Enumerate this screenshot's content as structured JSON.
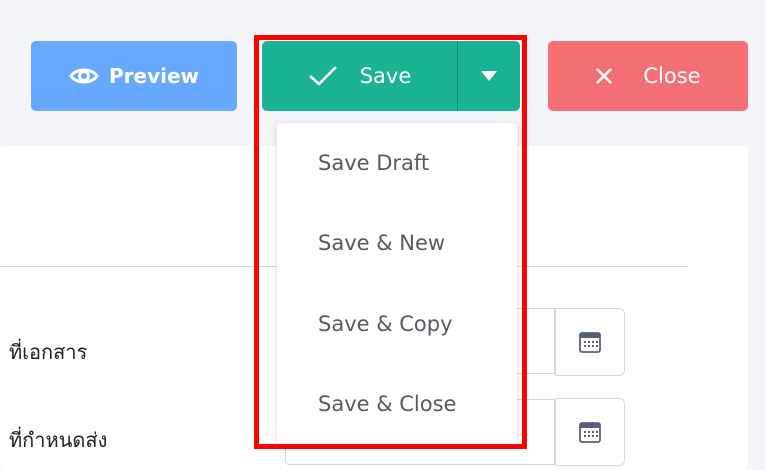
{
  "toolbar": {
    "preview_label": "Preview",
    "save_label": "Save",
    "close_label": "Close",
    "preview_icon": "eye-icon",
    "save_icon": "checkmark-icon",
    "caret_icon": "caret-down-icon",
    "close_icon": "close-icon"
  },
  "save_menu": {
    "items": [
      {
        "label": "Save Draft"
      },
      {
        "label": "Save & New"
      },
      {
        "label": "Save & Copy"
      },
      {
        "label": "Save & Close"
      }
    ]
  },
  "form": {
    "doc_date_label": "ที่เอกสาร",
    "due_date_label": "ที่กำหนดส่ง",
    "calendar_icon": "calendar-icon"
  },
  "colors": {
    "preview": "#66a9ff",
    "save": "#1ab394",
    "close": "#f47076",
    "highlight": "#ff0000"
  }
}
